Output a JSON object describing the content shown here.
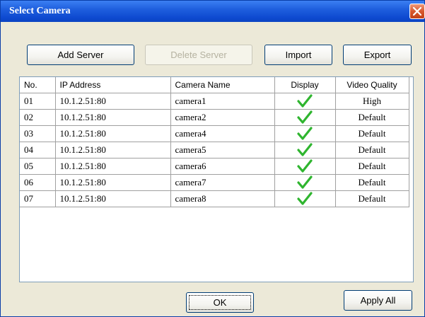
{
  "window": {
    "title": "Select Camera"
  },
  "toolbar": {
    "add_server": "Add Server",
    "delete_server": "Delete Server",
    "import": "Import",
    "export": "Export"
  },
  "table": {
    "columns": [
      "No.",
      "IP Address",
      "Camera Name",
      "Display",
      "Video Quality"
    ],
    "rows": [
      {
        "no": "01",
        "ip": "10.1.2.51:80",
        "name": "camera1",
        "display": true,
        "quality": "High"
      },
      {
        "no": "02",
        "ip": "10.1.2.51:80",
        "name": "camera2",
        "display": true,
        "quality": "Default"
      },
      {
        "no": "03",
        "ip": "10.1.2.51:80",
        "name": "camera4",
        "display": true,
        "quality": "Default"
      },
      {
        "no": "04",
        "ip": "10.1.2.51:80",
        "name": "camera5",
        "display": true,
        "quality": "Default"
      },
      {
        "no": "05",
        "ip": "10.1.2.51:80",
        "name": "camera6",
        "display": true,
        "quality": "Default"
      },
      {
        "no": "06",
        "ip": "10.1.2.51:80",
        "name": "camera7",
        "display": true,
        "quality": "Default"
      },
      {
        "no": "07",
        "ip": "10.1.2.51:80",
        "name": "camera8",
        "display": true,
        "quality": "Default"
      }
    ]
  },
  "footer": {
    "ok": "OK",
    "apply_all": "Apply All"
  },
  "colors": {
    "titlebar": "#1f5fde",
    "check": "#2fb52f",
    "close": "#d7582e"
  },
  "icons": {
    "close": "close-icon",
    "display_check": "checkmark-icon"
  }
}
